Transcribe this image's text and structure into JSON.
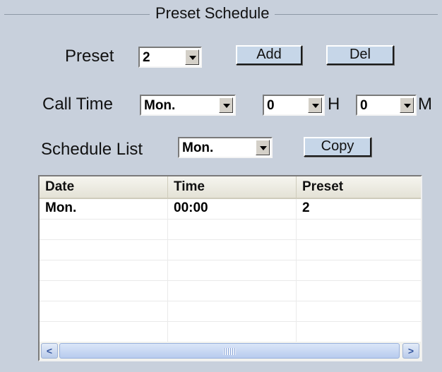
{
  "group": {
    "title": "Preset Schedule"
  },
  "preset": {
    "label": "Preset",
    "value": "2",
    "add_label": "Add",
    "del_label": "Del"
  },
  "call_time": {
    "label": "Call Time",
    "day": "Mon.",
    "hour": "0",
    "hour_unit": "H",
    "minute": "0",
    "minute_unit": "M"
  },
  "schedule_list": {
    "label": "Schedule List",
    "day": "Mon.",
    "copy_label": "Copy"
  },
  "table": {
    "columns": [
      "Date",
      "Time",
      "Preset"
    ],
    "rows": [
      [
        "Mon.",
        "00:00",
        "2"
      ],
      [
        "",
        "",
        ""
      ],
      [
        "",
        "",
        ""
      ],
      [
        "",
        "",
        ""
      ],
      [
        "",
        "",
        ""
      ],
      [
        "",
        "",
        ""
      ],
      [
        "",
        "",
        ""
      ]
    ]
  },
  "scrollbar": {
    "left_icon": "left-arrow-icon",
    "right_icon": "right-arrow-icon",
    "left_glyph": "<",
    "right_glyph": ">"
  }
}
